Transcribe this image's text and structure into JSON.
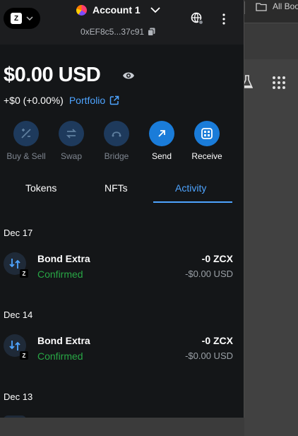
{
  "browser": {
    "bookmarks_label": "All Boo"
  },
  "header": {
    "network_badge": "Z",
    "account_name": "Account 1",
    "address": "0xEF8c5...37c91"
  },
  "balance": {
    "amount": "$0.00 USD",
    "change": "+$0 (+0.00%)",
    "portfolio_label": "Portfolio"
  },
  "actions": [
    {
      "label": "Buy & Sell",
      "icon": "buy-sell-icon",
      "enabled": false
    },
    {
      "label": "Swap",
      "icon": "swap-icon",
      "enabled": false
    },
    {
      "label": "Bridge",
      "icon": "bridge-icon",
      "enabled": false
    },
    {
      "label": "Send",
      "icon": "send-arrow-icon",
      "enabled": true
    },
    {
      "label": "Receive",
      "icon": "qr-icon",
      "enabled": true
    }
  ],
  "tabs": [
    {
      "label": "Tokens",
      "active": false
    },
    {
      "label": "NFTs",
      "active": false
    },
    {
      "label": "Activity",
      "active": true
    }
  ],
  "activity": [
    {
      "date": "Dec 17",
      "title": "Bond Extra",
      "status": "Confirmed",
      "amount": "-0 ZCX",
      "fiat": "-$0.00 USD",
      "badge": "Z"
    },
    {
      "date": "Dec 14",
      "title": "Bond Extra",
      "status": "Confirmed",
      "amount": "-0 ZCX",
      "fiat": "-$0.00 USD",
      "badge": "Z"
    },
    {
      "date": "Dec 13"
    }
  ],
  "colors": {
    "accent": "#4ea4ff",
    "confirmed": "#28a745",
    "action_bright": "#1a7cd9",
    "action_dim": "#1e3a5c"
  }
}
